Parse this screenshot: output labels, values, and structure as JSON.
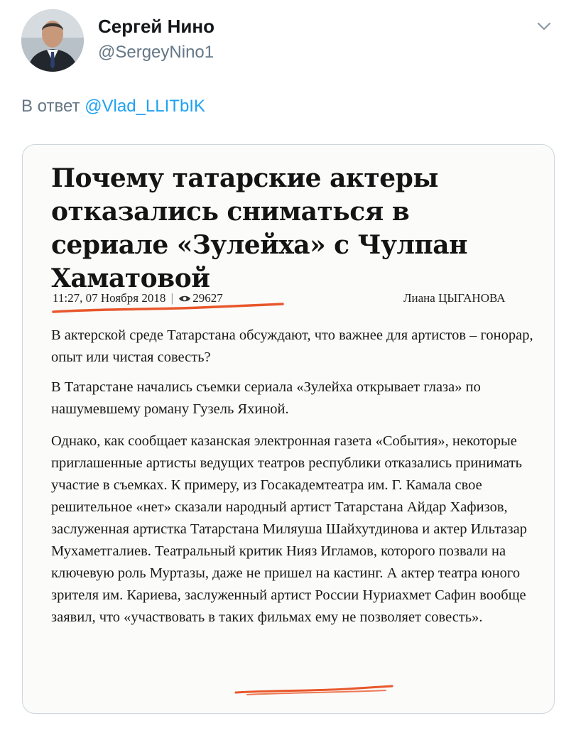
{
  "tweet": {
    "author_name": "Сергей Нино",
    "author_handle": "@SergeyNino1",
    "menu_icon": "chevron-down-icon",
    "reply_prefix": "В ответ",
    "reply_to": "@Vlad_LLITbIK"
  },
  "article": {
    "headline": "Почему татарские актеры отказались сниматься в сериале «Зулейха» с Чулпан Хаматовой",
    "date": "11:27, 07 Ноября 2018",
    "separator": "|",
    "views_icon": "eye-icon",
    "views": "29627",
    "author": "Лиана ЦЫГАНОВА",
    "paragraphs": [
      "В актерской среде Татарстана обсуждают, что важнее для артистов – гонорар, опыт или чистая совесть?",
      "В Татарстане начались съемки сериала «Зулейха открывает глаза» по нашумевшему роману Гузель Яхиной.",
      "Однако, как сообщает казанская электронная газета «События», некоторые  приглашенные артисты ведущих театров республики отказались принимать участие в съемках. К примеру, из Госакадемтеатра  им. Г. Камала свое решительное «нет» сказали народный артист Татарстана Айдар Хафизов, заслуженная артистка Татарстана Миляуша Шайхутдинова и актер Ильтазар Мухаметгалиев. Театральный критик Нияз Игламов, которого позвали на ключевую роль Муртазы, даже не пришел на кастинг. А актер театра юного зрителя им. Кариева, заслуженный артист России Нуриахмет Сафин вообще заявил, что «участвовать в таких фильмах ему не позволяет совесть»."
    ]
  },
  "colors": {
    "link": "#1da1f2",
    "muted": "#657786",
    "highlight": "#e8572b"
  }
}
